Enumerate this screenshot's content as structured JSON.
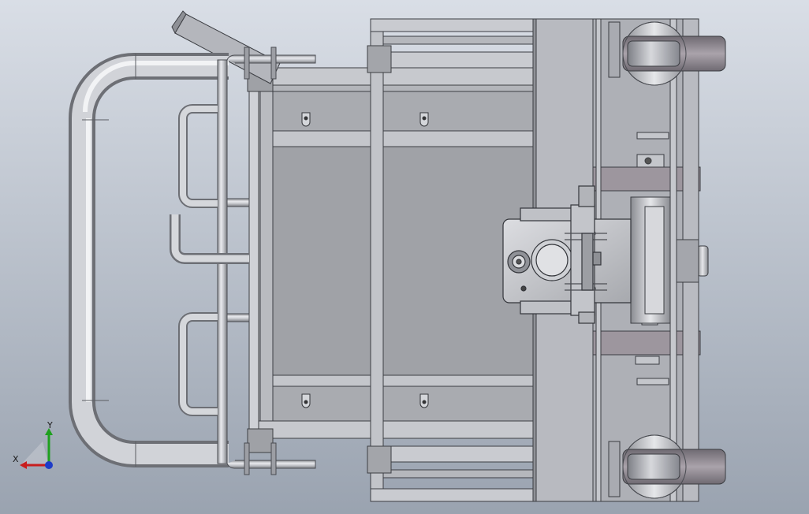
{
  "viewport": {
    "background_top": "#d9dee6",
    "background_bottom": "#9aa3b0"
  },
  "triad": {
    "x_label": "X",
    "y_label": "Y",
    "x_color": "#c81e1e",
    "y_color": "#1ea01e",
    "z_color": "#1e3cc8"
  },
  "icons": [
    "view-triad-icon"
  ]
}
